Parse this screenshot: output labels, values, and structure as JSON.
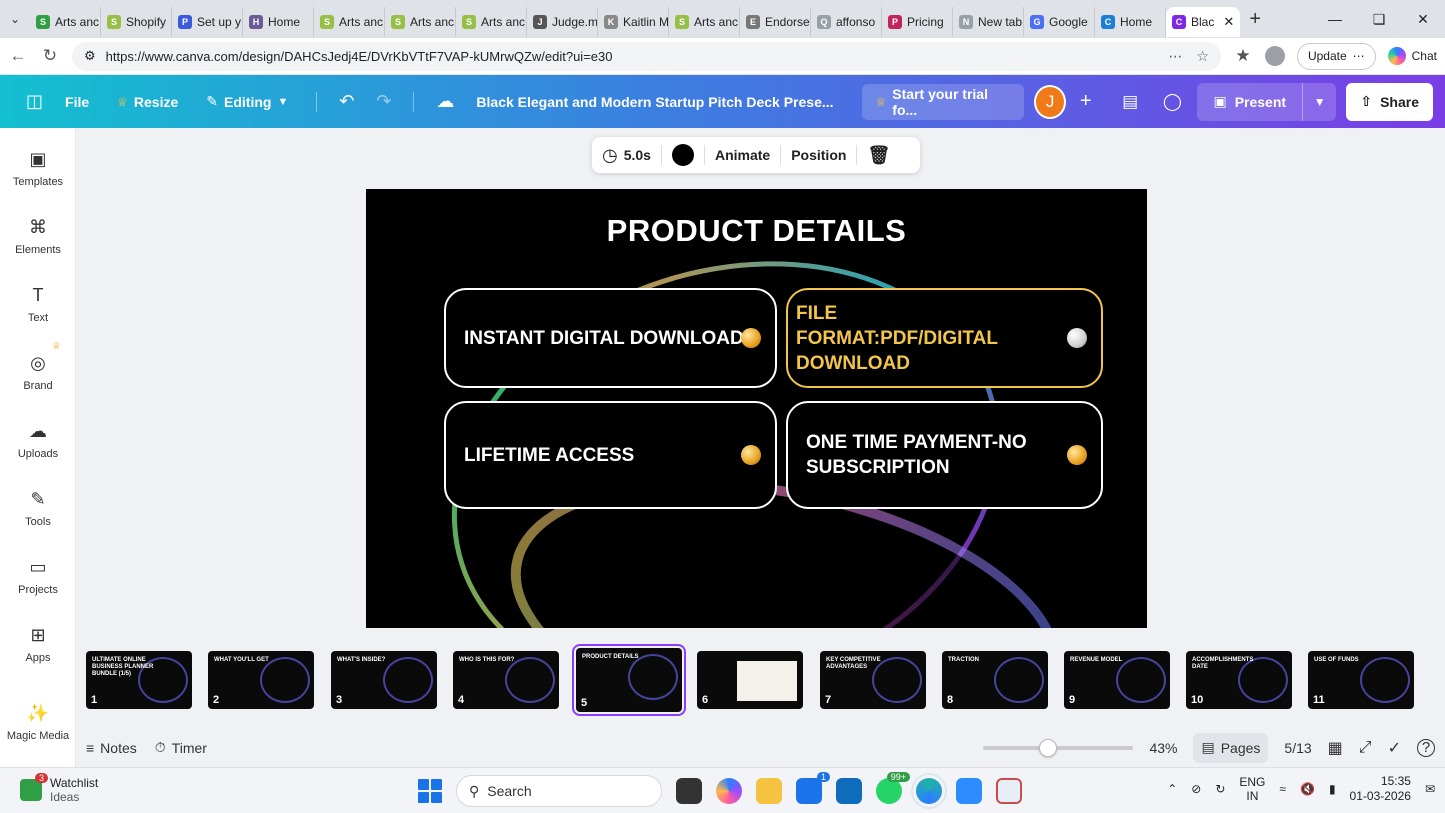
{
  "browser": {
    "tabs": [
      {
        "label": "Arts anc",
        "color": "#2f9e44",
        "glyph": "S"
      },
      {
        "label": "Shopify",
        "color": "#95bf47",
        "glyph": "S"
      },
      {
        "label": "Set up y",
        "color": "#3b5bdb",
        "glyph": "P"
      },
      {
        "label": "Home",
        "color": "#6b5b95",
        "glyph": "H"
      },
      {
        "label": "Arts anc",
        "color": "#95bf47",
        "glyph": "S"
      },
      {
        "label": "Arts anc",
        "color": "#95bf47",
        "glyph": "S"
      },
      {
        "label": "Arts anc",
        "color": "#95bf47",
        "glyph": "S"
      },
      {
        "label": "Judge.m",
        "color": "#555555",
        "glyph": "J"
      },
      {
        "label": "Kaitlin M",
        "color": "#888888",
        "glyph": "K"
      },
      {
        "label": "Arts anc",
        "color": "#95bf47",
        "glyph": "S"
      },
      {
        "label": "Endorse",
        "color": "#777777",
        "glyph": "E"
      },
      {
        "label": "affonso",
        "color": "#9aa0a6",
        "glyph": "Q"
      },
      {
        "label": "Pricing",
        "color": "#c2255c",
        "glyph": "P"
      },
      {
        "label": "New tab",
        "color": "#9aa0a6",
        "glyph": "N"
      },
      {
        "label": "Google",
        "color": "#4c6ef5",
        "glyph": "G"
      },
      {
        "label": "Home",
        "color": "#1c7ed6",
        "glyph": "C"
      }
    ],
    "active_tab": {
      "label": "Blac",
      "color": "#7d2ae8",
      "glyph": "C"
    },
    "url": "https://www.canva.com/design/DAHCsJedj4E/DVrKbVTtF7VAP-kUMrwQZw/edit?ui=e30",
    "update_label": "Update",
    "chat_label": "Chat"
  },
  "header": {
    "file": "File",
    "resize": "Resize",
    "editing": "Editing",
    "doc_title": "Black Elegant and Modern Startup Pitch Deck Prese...",
    "trial": "Start your trial fo...",
    "avatar_initial": "J",
    "present": "Present",
    "share": "Share"
  },
  "sidebar": {
    "items": [
      {
        "label": "Templates",
        "icon": "templates-icon"
      },
      {
        "label": "Elements",
        "icon": "elements-icon"
      },
      {
        "label": "Text",
        "icon": "text-icon"
      },
      {
        "label": "Brand",
        "icon": "brand-icon"
      },
      {
        "label": "Uploads",
        "icon": "uploads-icon"
      },
      {
        "label": "Tools",
        "icon": "tools-icon"
      },
      {
        "label": "Projects",
        "icon": "projects-icon"
      },
      {
        "label": "Apps",
        "icon": "apps-icon"
      },
      {
        "label": "Magic Media",
        "icon": "magic-media-icon"
      }
    ]
  },
  "toolbar": {
    "duration": "5.0s",
    "color": "#000000",
    "animate": "Animate",
    "position": "Position"
  },
  "slide": {
    "title": "PRODUCT DETAILS",
    "cards": [
      {
        "text": "INSTANT DIGITAL DOWNLOAD",
        "style": "white"
      },
      {
        "text": "FILE FORMAT:PDF/DIGITAL DOWNLOAD",
        "style": "gold"
      },
      {
        "text": "LIFETIME ACCESS",
        "style": "white"
      },
      {
        "text": "ONE TIME PAYMENT-NO SUBSCRIPTION",
        "style": "white"
      }
    ]
  },
  "thumbnails": [
    {
      "num": "1",
      "title": "ULTIMATE ONLINE BUSINESS PLANNER BUNDLE (1/5)"
    },
    {
      "num": "2",
      "title": "WHAT YOU'LL GET"
    },
    {
      "num": "3",
      "title": "WHAT'S INSIDE?"
    },
    {
      "num": "4",
      "title": "WHO IS THIS FOR?"
    },
    {
      "num": "5",
      "title": "PRODUCT DETAILS"
    },
    {
      "num": "6",
      "title": ""
    },
    {
      "num": "7",
      "title": "KEY COMPETITIVE ADVANTAGES"
    },
    {
      "num": "8",
      "title": "TRACTION"
    },
    {
      "num": "9",
      "title": "REVENUE MODEL"
    },
    {
      "num": "10",
      "title": "ACCOMPLISHMENTS DATE"
    },
    {
      "num": "11",
      "title": "USE OF FUNDS"
    }
  ],
  "bottom": {
    "notes": "Notes",
    "timer": "Timer",
    "zoom": "43%",
    "zoom_level": 0.43,
    "pages": "Pages",
    "page_count": "5/13"
  },
  "taskbar": {
    "watchlist": "Watchlist",
    "watchlist_sub": "Ideas",
    "watchlist_badge": "3",
    "search": "Search",
    "outlook_badge": "1",
    "whatsapp_badge": "99+",
    "lang": "ENG",
    "region": "IN",
    "time": "15:35",
    "date": "01-03-2026"
  }
}
